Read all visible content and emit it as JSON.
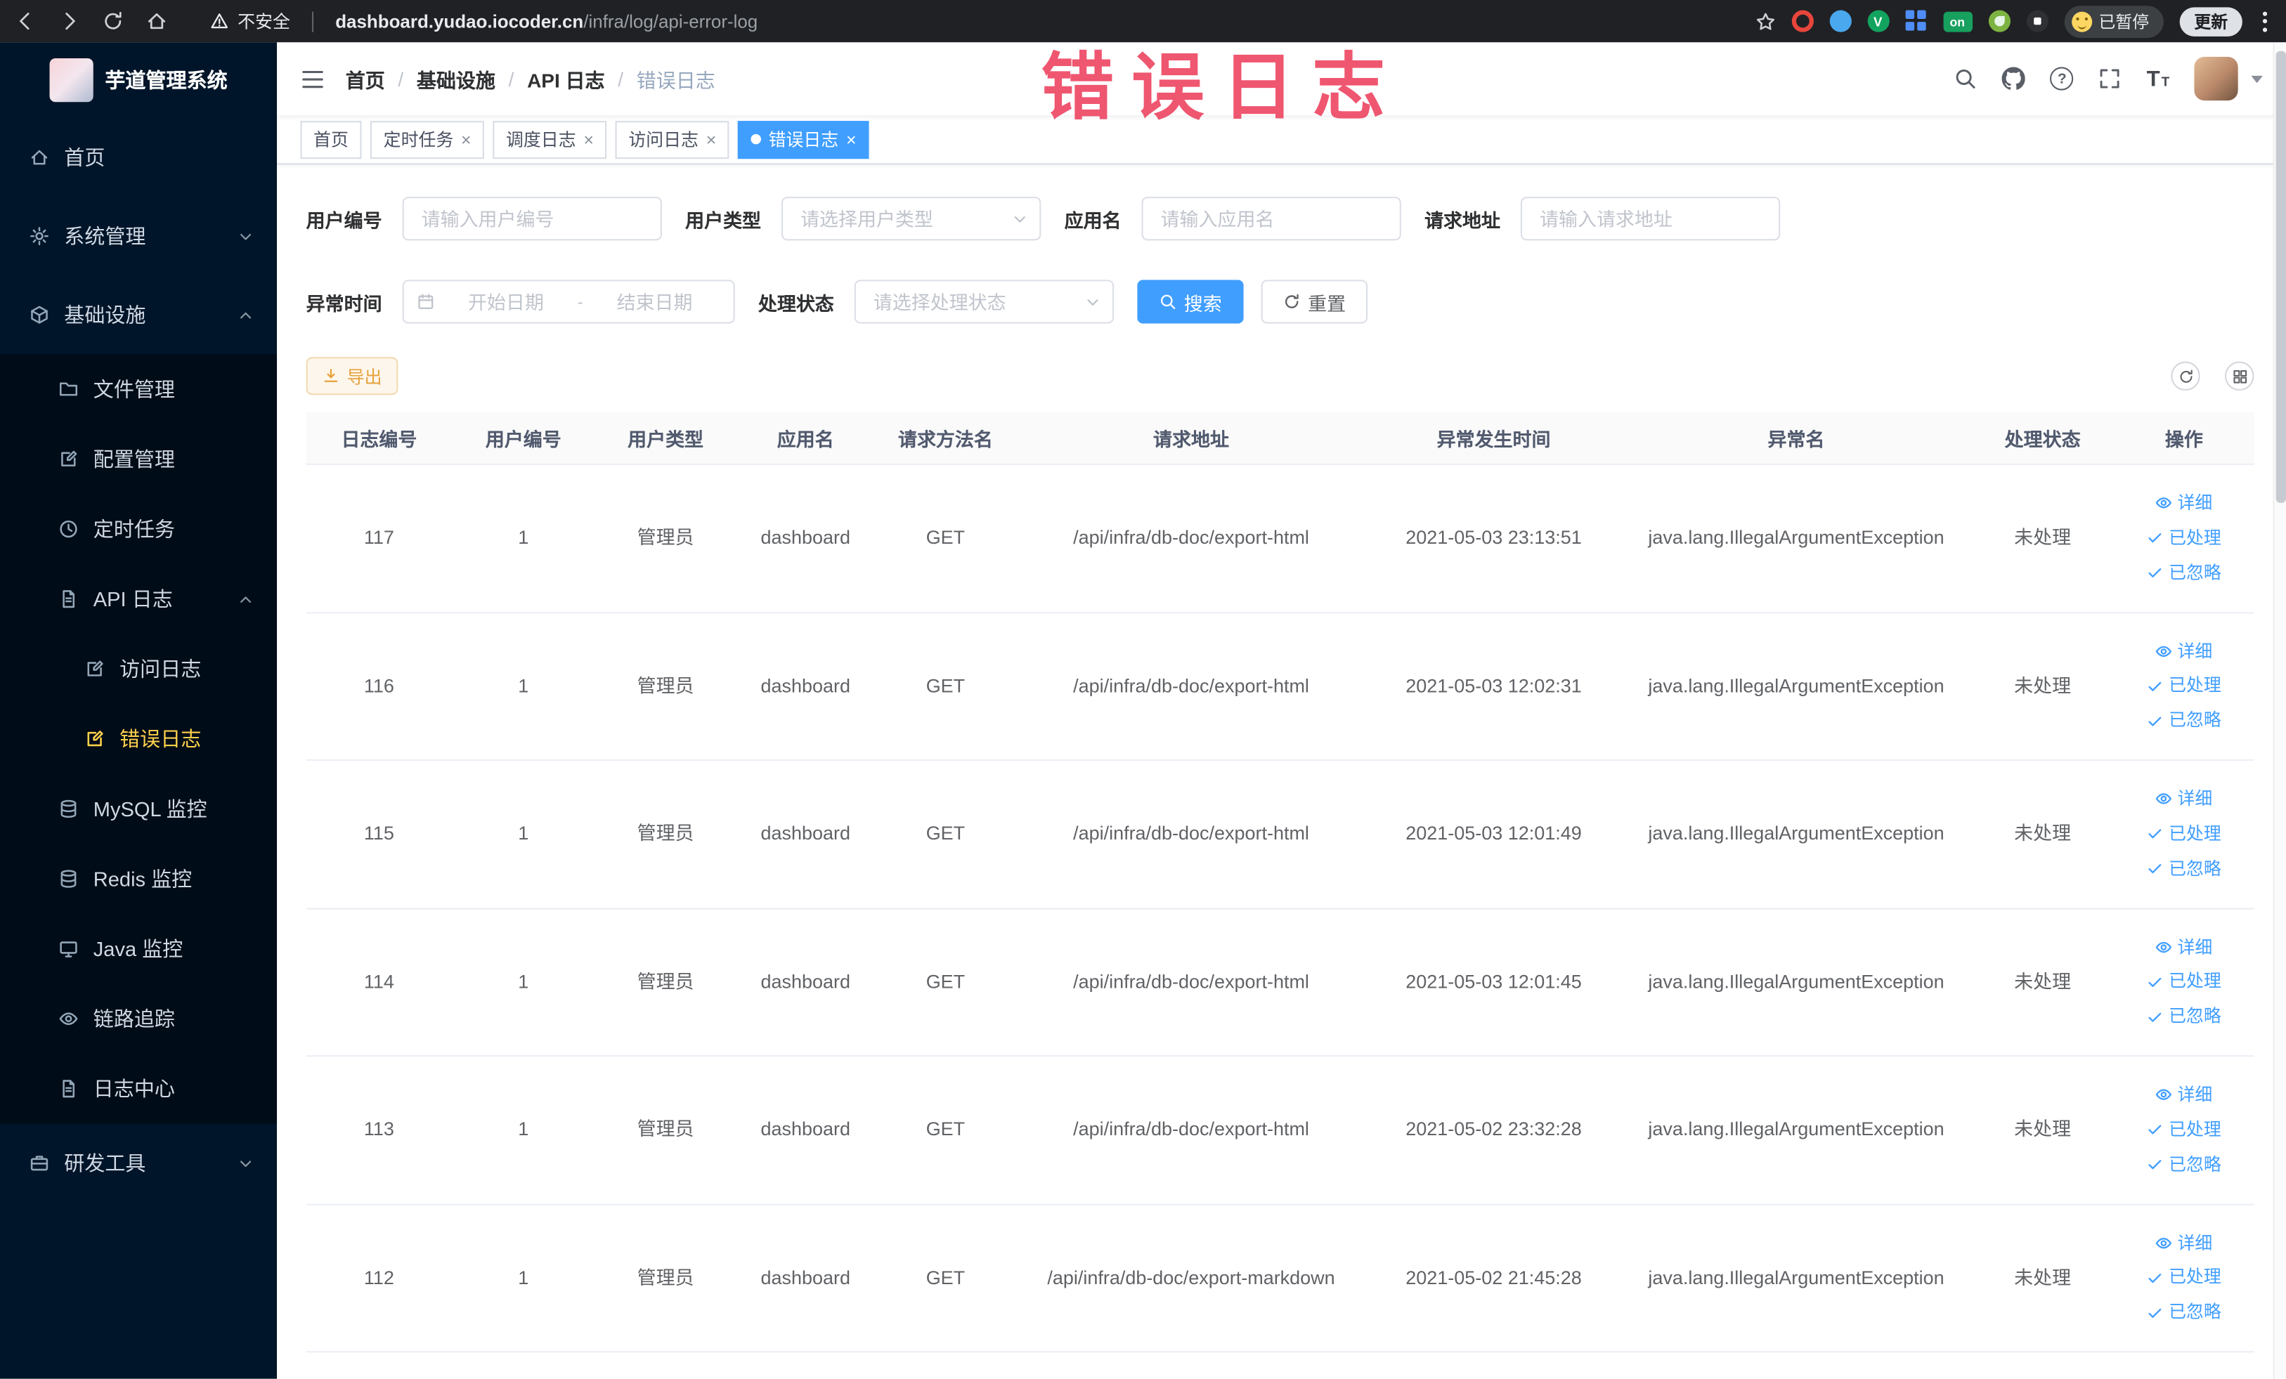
{
  "browser": {
    "security_label": "不安全",
    "url_domain": "dashboard.yudao.iocoder.cn",
    "url_path": "/infra/log/api-error-log",
    "extension_on_badge": "on",
    "profile_badge": "已暂停",
    "update_button": "更新"
  },
  "annotation": {
    "title": "错误日志",
    "color": "#ee4a66"
  },
  "sidebar": {
    "logo_title": "芋道管理系统",
    "active_item": "错误日志",
    "colors": {
      "bg": "#001529",
      "submenu_bg": "#000c17",
      "text": "#cfd8e3",
      "active_text": "#ffd04b"
    },
    "items": {
      "home": "首页",
      "system": "系统管理",
      "infra": "基础设施",
      "file": "文件管理",
      "config": "配置管理",
      "job": "定时任务",
      "api_log": "API 日志",
      "access_log": "访问日志",
      "error_log": "错误日志",
      "mysql": "MySQL 监控",
      "redis": "Redis 监控",
      "java": "Java 监控",
      "trace": "链路追踪",
      "log_center": "日志中心",
      "dev_tool": "研发工具"
    }
  },
  "header": {
    "breadcrumb": [
      "首页",
      "基础设施",
      "API 日志",
      "错误日志"
    ]
  },
  "tabs": [
    {
      "label": "首页",
      "closable": false,
      "active": false
    },
    {
      "label": "定时任务",
      "closable": true,
      "active": false
    },
    {
      "label": "调度日志",
      "closable": true,
      "active": false
    },
    {
      "label": "访问日志",
      "closable": true,
      "active": false
    },
    {
      "label": "错误日志",
      "closable": true,
      "active": true
    }
  ],
  "filters": {
    "user_id": {
      "label": "用户编号",
      "placeholder": "请输入用户编号",
      "value": ""
    },
    "user_type": {
      "label": "用户类型",
      "placeholder": "请选择用户类型",
      "value": ""
    },
    "app_name": {
      "label": "应用名",
      "placeholder": "请输入应用名",
      "value": ""
    },
    "request_url": {
      "label": "请求地址",
      "placeholder": "请输入请求地址",
      "value": ""
    },
    "exception_time": {
      "label": "异常时间",
      "start_placeholder": "开始日期",
      "separator": "-",
      "end_placeholder": "结束日期"
    },
    "process_status": {
      "label": "处理状态",
      "placeholder": "请选择处理状态",
      "value": ""
    },
    "search_button": "搜索",
    "reset_button": "重置"
  },
  "toolbar": {
    "export_button": "导出"
  },
  "table": {
    "columns": [
      "日志编号",
      "用户编号",
      "用户类型",
      "应用名",
      "请求方法名",
      "请求地址",
      "异常发生时间",
      "异常名",
      "处理状态",
      "操作"
    ],
    "action_labels": {
      "detail": "详细",
      "processed": "已处理",
      "ignored": "已忽略"
    },
    "rows": [
      {
        "log_id": "117",
        "user_id": "1",
        "user_type": "管理员",
        "app_name": "dashboard",
        "method": "GET",
        "url": "/api/infra/db-doc/export-html",
        "time": "2021-05-03 23:13:51",
        "exception": "java.lang.IllegalArgumentException",
        "status": "未处理"
      },
      {
        "log_id": "116",
        "user_id": "1",
        "user_type": "管理员",
        "app_name": "dashboard",
        "method": "GET",
        "url": "/api/infra/db-doc/export-html",
        "time": "2021-05-03 12:02:31",
        "exception": "java.lang.IllegalArgumentException",
        "status": "未处理"
      },
      {
        "log_id": "115",
        "user_id": "1",
        "user_type": "管理员",
        "app_name": "dashboard",
        "method": "GET",
        "url": "/api/infra/db-doc/export-html",
        "time": "2021-05-03 12:01:49",
        "exception": "java.lang.IllegalArgumentException",
        "status": "未处理"
      },
      {
        "log_id": "114",
        "user_id": "1",
        "user_type": "管理员",
        "app_name": "dashboard",
        "method": "GET",
        "url": "/api/infra/db-doc/export-html",
        "time": "2021-05-03 12:01:45",
        "exception": "java.lang.IllegalArgumentException",
        "status": "未处理"
      },
      {
        "log_id": "113",
        "user_id": "1",
        "user_type": "管理员",
        "app_name": "dashboard",
        "method": "GET",
        "url": "/api/infra/db-doc/export-html",
        "time": "2021-05-02 23:32:28",
        "exception": "java.lang.IllegalArgumentException",
        "status": "未处理"
      },
      {
        "log_id": "112",
        "user_id": "1",
        "user_type": "管理员",
        "app_name": "dashboard",
        "method": "GET",
        "url": "/api/infra/db-doc/export-markdown",
        "time": "2021-05-02 21:45:28",
        "exception": "java.lang.IllegalArgumentException",
        "status": "未处理"
      }
    ]
  },
  "colors": {
    "primary": "#409eff",
    "warning": "#e6a23c",
    "sidebar_bg": "#001529",
    "chrome_bg": "#202124"
  },
  "icons": {
    "security": "warning-triangle",
    "bookmark": "star",
    "help": "question-circle",
    "search": "magnifier",
    "repo": "octocat",
    "fullscreen": "expand-arrows",
    "font_size": "text-T",
    "export": "download-arrow",
    "refresh": "circular-arrows",
    "columns": "grid",
    "detail": "eye",
    "processed": "check",
    "ignored": "check",
    "date": "calendar"
  }
}
